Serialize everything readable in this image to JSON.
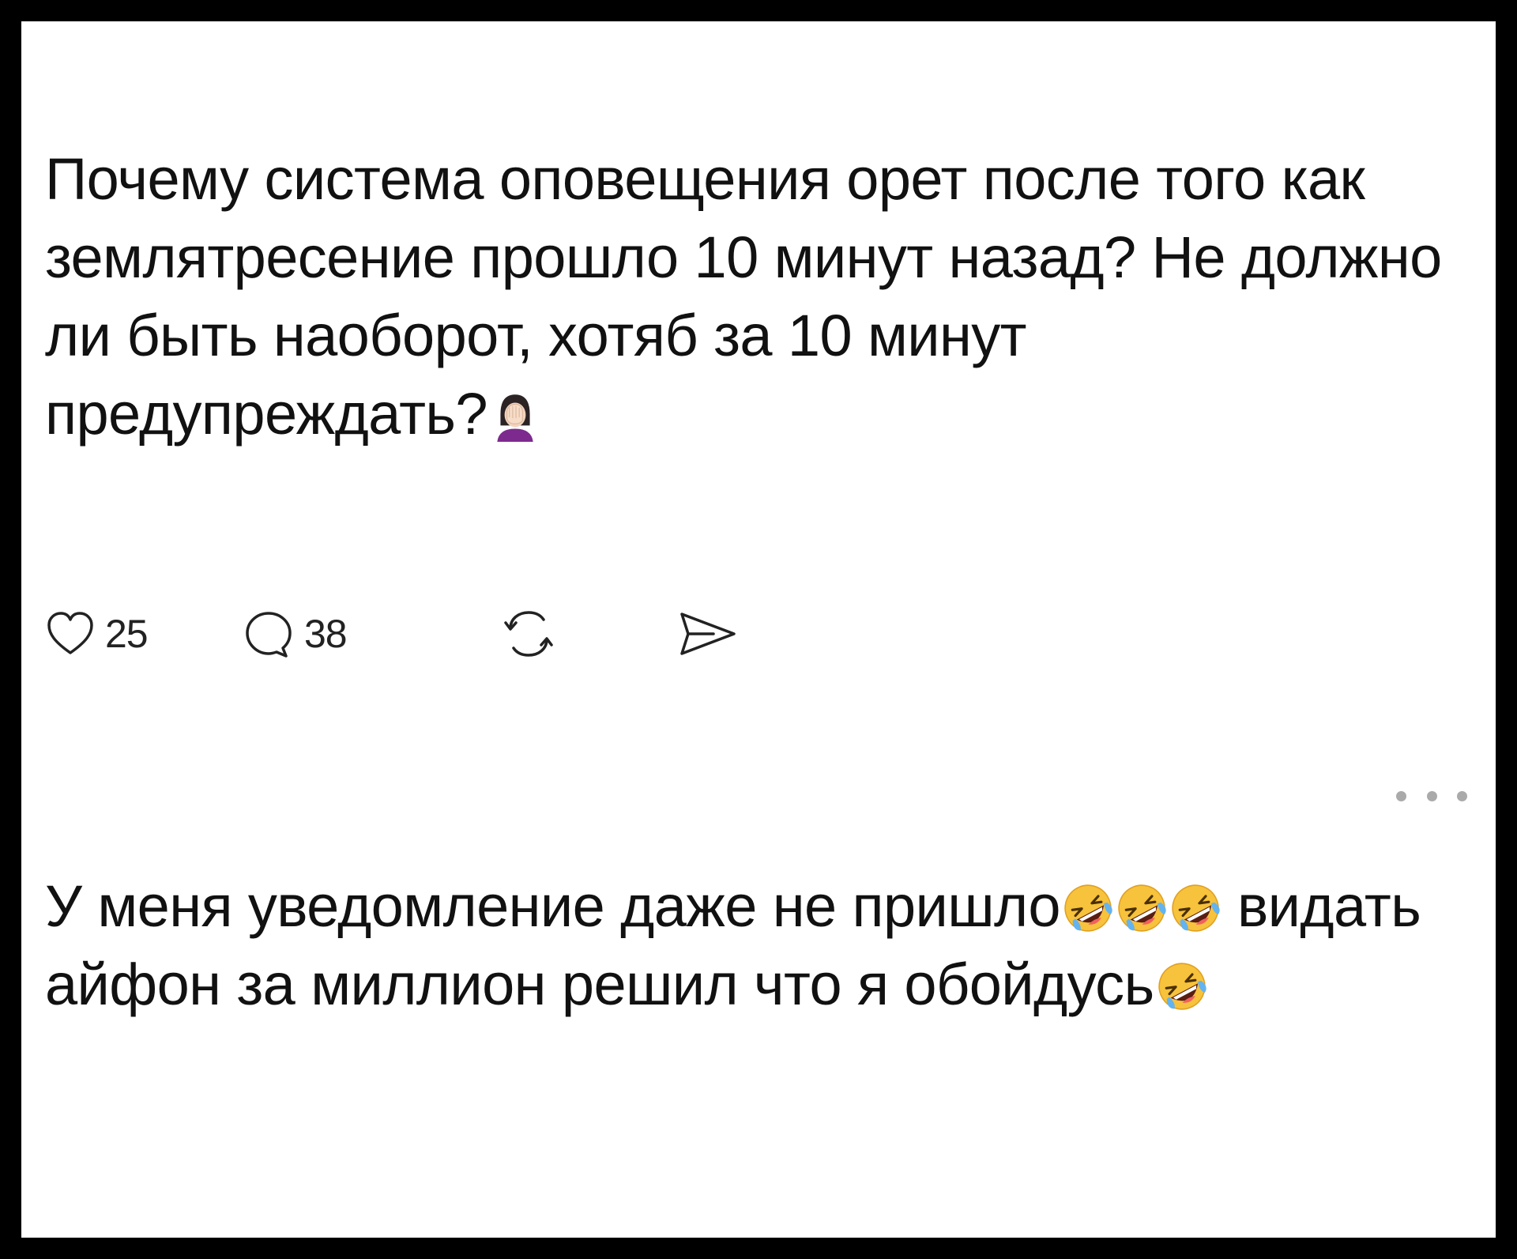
{
  "post": {
    "text": "Почему система оповещения орет после того как землятресение прошло 10 минут назад? Не должно ли быть наоборот, хотяб за 10 минут предупреждать?",
    "emoji_icon": "woman-facepalming-emoji",
    "likes": "25",
    "replies": "38"
  },
  "comment": {
    "segment1": "У меня уведомление даже не пришло",
    "segment2": " видать айфон за миллион решил что я обойдусь",
    "emoji_icon": "rolling-on-floor-laughing-emoji"
  },
  "colors": {
    "frame": "#000000",
    "background": "#ffffff",
    "text": "#111111",
    "icon": "#222222",
    "more_dots": "#aaaaaa"
  }
}
